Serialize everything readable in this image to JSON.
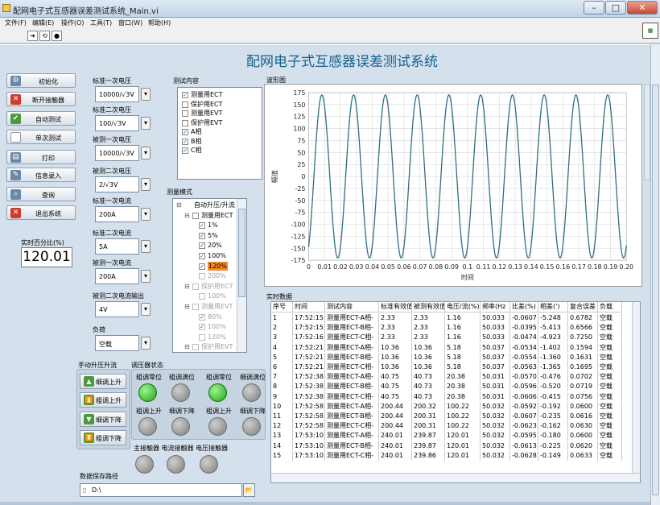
{
  "window": {
    "title": "配网电子式互感器误差测试系统_Main.vi"
  },
  "menu": [
    "文件(F)",
    "编辑(E)",
    "操作(O)",
    "工具(T)",
    "窗口(W)",
    "帮助(H)"
  ],
  "main_title": "配网电子式互感器误差测试系统",
  "side_buttons": [
    {
      "label": "初始化",
      "icon": "gear-icon",
      "color": "#6a88a8"
    },
    {
      "label": "断开接触器",
      "icon": "cancel-icon",
      "color": "#d33a2c"
    },
    {
      "label": "自动测试",
      "icon": "check-icon",
      "color": "#4a9a3c"
    },
    {
      "label": "单次测试",
      "icon": "blank-icon",
      "color": "#ffffff"
    },
    {
      "label": "打印",
      "icon": "printer-icon",
      "color": "#6a88a8"
    },
    {
      "label": "信息录入",
      "icon": "wrench-icon",
      "color": "#6a88a8"
    },
    {
      "label": "查询",
      "icon": "magnifier-icon",
      "color": "#6a88a8"
    },
    {
      "label": "退出系统",
      "icon": "exit-icon",
      "color": "#d33a2c"
    }
  ],
  "pct": {
    "label": "实时百分比(%)",
    "value": "120.01"
  },
  "params": [
    {
      "label": "标准一次电压",
      "value": "10000/√3V"
    },
    {
      "label": "标准二次电压",
      "value": "100/√3V"
    },
    {
      "label": "被测一次电压",
      "value": "10000/√3V"
    },
    {
      "label": "被测二次电压",
      "value": "2/√3V"
    },
    {
      "label": "标准一次电流",
      "value": "200A"
    },
    {
      "label": "标准二次电流",
      "value": "5A"
    },
    {
      "label": "被测一次电流",
      "value": "200A"
    },
    {
      "label": "被测二次电流输出",
      "value": "4V"
    },
    {
      "label": "负荷",
      "value": "空载"
    }
  ],
  "test_content": {
    "label": "测试内容",
    "items": [
      {
        "text": "测量用ECT",
        "checked": true
      },
      {
        "text": "保护用ECT",
        "checked": false
      },
      {
        "text": "测量用EVT",
        "checked": false
      },
      {
        "text": "保护用EVT",
        "checked": false
      },
      {
        "text": "A相",
        "checked": true
      },
      {
        "text": "B相",
        "checked": true
      },
      {
        "text": "C相",
        "checked": true
      }
    ]
  },
  "measure_mode": {
    "label": "测量模式",
    "items": [
      {
        "text": "自动升压/升流",
        "indent": 1,
        "checked": null,
        "gray": false,
        "sel": false,
        "tree": "⊟"
      },
      {
        "text": "测量用ECT",
        "indent": 2,
        "checked": false,
        "gray": false,
        "sel": false,
        "tree": "⊟"
      },
      {
        "text": "1%",
        "indent": 3,
        "checked": true,
        "gray": false,
        "sel": false,
        "tree": ""
      },
      {
        "text": "5%",
        "indent": 3,
        "checked": true,
        "gray": false,
        "sel": false,
        "tree": ""
      },
      {
        "text": "20%",
        "indent": 3,
        "checked": true,
        "gray": false,
        "sel": false,
        "tree": ""
      },
      {
        "text": "100%",
        "indent": 3,
        "checked": true,
        "gray": false,
        "sel": false,
        "tree": ""
      },
      {
        "text": "120%",
        "indent": 3,
        "checked": true,
        "gray": false,
        "sel": true,
        "tree": ""
      },
      {
        "text": "200%",
        "indent": 3,
        "checked": false,
        "gray": true,
        "sel": false,
        "tree": ""
      },
      {
        "text": "保护用ECT",
        "indent": 2,
        "checked": false,
        "gray": true,
        "sel": false,
        "tree": "⊟"
      },
      {
        "text": "100%",
        "indent": 3,
        "checked": false,
        "gray": true,
        "sel": false,
        "tree": ""
      },
      {
        "text": "测量用EVT",
        "indent": 2,
        "checked": false,
        "gray": true,
        "sel": false,
        "tree": "⊟"
      },
      {
        "text": "80%",
        "indent": 3,
        "checked": true,
        "gray": true,
        "sel": false,
        "tree": ""
      },
      {
        "text": "100%",
        "indent": 3,
        "checked": true,
        "gray": true,
        "sel": false,
        "tree": ""
      },
      {
        "text": "120%",
        "indent": 3,
        "checked": false,
        "gray": true,
        "sel": false,
        "tree": ""
      },
      {
        "text": "保护用EVT",
        "indent": 2,
        "checked": false,
        "gray": true,
        "sel": false,
        "tree": "⊟"
      }
    ]
  },
  "waveform": {
    "label": "波形图"
  },
  "chart_data": {
    "type": "line",
    "title": "",
    "xlabel": "时间",
    "ylabel": "幅值",
    "xlim": [
      0,
      0.2
    ],
    "ylim": [
      -175,
      175
    ],
    "x_ticks": [
      "0",
      "0.01",
      "0.02",
      "0.03",
      "0.04",
      "0.05",
      "0.06",
      "0.07",
      "0.08",
      "0.09",
      "0.1",
      "0.11",
      "0.12",
      "0.13",
      "0.14",
      "0.15",
      "0.16",
      "0.17",
      "0.18",
      "0.19",
      "0.20"
    ],
    "y_ticks": [
      "175",
      "150",
      "125",
      "100",
      "75",
      "50",
      "25",
      "0",
      "-25",
      "-50",
      "-75",
      "-100",
      "-125",
      "-150",
      "-175"
    ],
    "series": [
      {
        "amplitude": 170,
        "frequency_hz": 50.03,
        "phase_deg": -60,
        "color": "#2c6f82"
      }
    ],
    "grid": true
  },
  "table": {
    "label": "实时数据",
    "columns": [
      "序号",
      "时间",
      "测试内容",
      "标准有效值",
      "被测有效值",
      "电压/流(%)",
      "频率(Hz",
      "比差(%)",
      "相差(')",
      "复合误差",
      "负载"
    ],
    "rows": [
      [
        "1",
        "17:52:15",
        "测量用ECT-A相-",
        "2.33",
        "2.33",
        "1.16",
        "50.033",
        "-0.0607",
        "-5.248",
        "0.6782",
        "空载"
      ],
      [
        "2",
        "17:52:15",
        "测量用ECT-B相-",
        "2.33",
        "2.33",
        "1.16",
        "50.033",
        "-0.0395",
        "-5.413",
        "0.6566",
        "空载"
      ],
      [
        "3",
        "17:52:16",
        "测量用ECT-C相-",
        "2.33",
        "2.33",
        "1.16",
        "50.033",
        "-0.0474",
        "-4.923",
        "0.7250",
        "空载"
      ],
      [
        "4",
        "17:52:21",
        "测量用ECT-A相-",
        "10.36",
        "10.36",
        "5.18",
        "50.037",
        "-0.0534",
        "-1.402",
        "0.1594",
        "空载"
      ],
      [
        "5",
        "17:52:21",
        "测量用ECT-B相-",
        "10.36",
        "10.36",
        "5.18",
        "50.037",
        "-0.0554",
        "-1.360",
        "0.1631",
        "空载"
      ],
      [
        "6",
        "17:52:21",
        "测量用ECT-C相-",
        "10.36",
        "10.36",
        "5.18",
        "50.037",
        "-0.0563",
        "-1.365",
        "0.1695",
        "空载"
      ],
      [
        "7",
        "17:52:38",
        "测量用ECT-A相-",
        "40.75",
        "40.73",
        "20.38",
        "50.031",
        "-0.0570",
        "-0.476",
        "0.0702",
        "空载"
      ],
      [
        "8",
        "17:52:38",
        "测量用ECT-B相-",
        "40.75",
        "40.73",
        "20.38",
        "50.031",
        "-0.0596",
        "-0.520",
        "0.0719",
        "空载"
      ],
      [
        "9",
        "17:52:38",
        "测量用ECT-C相-",
        "40.75",
        "40.73",
        "20.38",
        "50.031",
        "-0.0606",
        "-0.415",
        "0.0756",
        "空载"
      ],
      [
        "10",
        "17:52:58",
        "测量用ECT-A相-",
        "200.44",
        "200.32",
        "100.22",
        "50.032",
        "-0.0592",
        "-0.192",
        "0.0600",
        "空载"
      ],
      [
        "11",
        "17:52:58",
        "测量用ECT-B相-",
        "200.44",
        "200.31",
        "100.22",
        "50.032",
        "-0.0607",
        "-0.235",
        "0.0616",
        "空载"
      ],
      [
        "12",
        "17:52:58",
        "测量用ECT-C相-",
        "200.44",
        "200.31",
        "100.22",
        "50.032",
        "-0.0623",
        "-0.162",
        "0.0630",
        "空载"
      ],
      [
        "13",
        "17:53:10",
        "测量用ECT-A相-",
        "240.01",
        "239.87",
        "120.01",
        "50.032",
        "-0.0595",
        "-0.180",
        "0.0600",
        "空载"
      ],
      [
        "14",
        "17:53:10",
        "测量用ECT-B相-",
        "240.01",
        "239.87",
        "120.01",
        "50.032",
        "-0.0613",
        "-0.225",
        "0.0620",
        "空载"
      ],
      [
        "15",
        "17:53:10",
        "测量用ECT-C相-",
        "240.01",
        "239.86",
        "120.01",
        "50.032",
        "-0.0628",
        "-0.149",
        "0.0633",
        "空载"
      ]
    ]
  },
  "manual": {
    "label": "手动升压升流",
    "buttons": [
      {
        "label": "细调上升",
        "icon": "arrow-up-icon"
      },
      {
        "label": "粗调上升",
        "icon": "double-arrow-up-icon"
      },
      {
        "label": "细调下降",
        "icon": "arrow-down-icon"
      },
      {
        "label": "粗调下降",
        "icon": "double-arrow-down-icon"
      }
    ]
  },
  "regulator": {
    "label": "调压器状态",
    "leds": [
      {
        "label": "粗调零位",
        "on": true
      },
      {
        "label": "粗调满位",
        "on": false
      },
      {
        "label": "粗调零位",
        "on": true
      },
      {
        "label": "细调满位",
        "on": false
      },
      {
        "label": "粗调上升",
        "on": false
      },
      {
        "label": "细调下降",
        "on": false
      },
      {
        "label": "粗调上升",
        "on": false
      },
      {
        "label": "细调下降",
        "on": false
      }
    ]
  },
  "contactors": {
    "label": "主接触器 电流接触器 电压接触器",
    "leds": [
      {
        "on": false
      },
      {
        "on": false
      },
      {
        "on": false
      }
    ]
  },
  "save_path": {
    "label": "数据保存路径",
    "value": "D:\\"
  }
}
